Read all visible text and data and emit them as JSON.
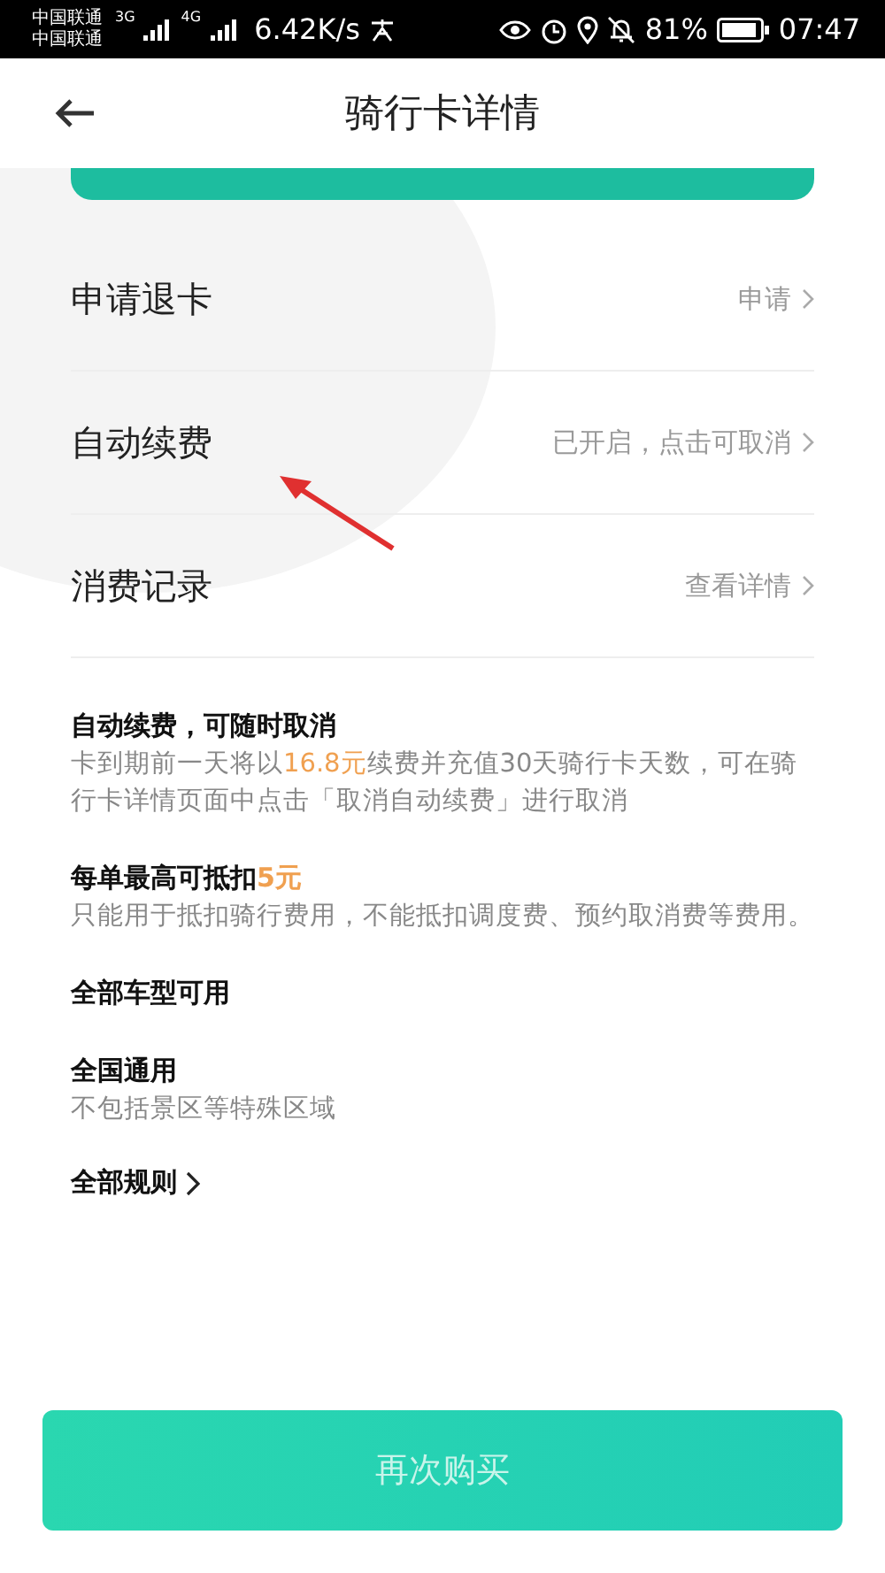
{
  "status_bar": {
    "carriers": [
      "中国联通",
      "中国联通"
    ],
    "networks": [
      "3G",
      "4G"
    ],
    "speed": "6.42K/s",
    "battery": "81%",
    "time": "07:47"
  },
  "nav": {
    "title": "骑行卡详情"
  },
  "rows": [
    {
      "label": "申请退卡",
      "value": "申请"
    },
    {
      "label": "自动续费",
      "value": "已开启，点击可取消"
    },
    {
      "label": "消费记录",
      "value": "查看详情"
    }
  ],
  "info": [
    {
      "title": [
        {
          "text": "自动续费，可随时取消",
          "highlight": false
        }
      ],
      "body": [
        {
          "text": "卡到期前一天将以",
          "highlight": false
        },
        {
          "text": "16.8元",
          "highlight": true
        },
        {
          "text": "续费并充值30天骑行卡天数，可在骑行卡详情页面中点击「取消自动续费」进行取消",
          "highlight": false
        }
      ]
    },
    {
      "title": [
        {
          "text": "每单最高可抵扣",
          "highlight": false
        },
        {
          "text": "5元",
          "highlight": true
        }
      ],
      "body": [
        {
          "text": "只能用于抵扣骑行费用，不能抵扣调度费、预约取消费等费用。",
          "highlight": false
        }
      ]
    },
    {
      "title": [
        {
          "text": "全部车型可用",
          "highlight": false
        }
      ]
    },
    {
      "title": [
        {
          "text": "全国通用",
          "highlight": false
        }
      ],
      "body": [
        {
          "text": "不包括景区等特殊区域",
          "highlight": false
        }
      ]
    }
  ],
  "rules_link": "全部规则",
  "buy_button": "再次购买"
}
